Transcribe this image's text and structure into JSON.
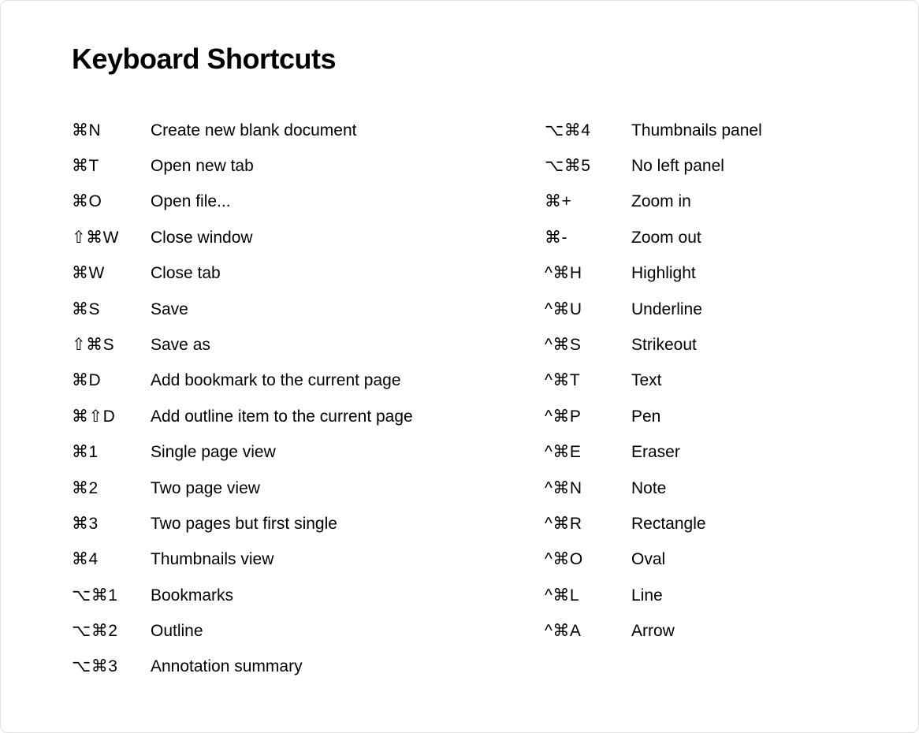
{
  "title": "Keyboard Shortcuts",
  "left": [
    {
      "keys": "⌘N",
      "desc": "Create new blank document"
    },
    {
      "keys": "⌘T",
      "desc": "Open new tab"
    },
    {
      "keys": "⌘O",
      "desc": "Open file..."
    },
    {
      "keys": "⇧⌘W",
      "desc": "Close window"
    },
    {
      "keys": "⌘W",
      "desc": "Close tab"
    },
    {
      "keys": "⌘S",
      "desc": "Save"
    },
    {
      "keys": "⇧⌘S",
      "desc": "Save as"
    },
    {
      "keys": "⌘D",
      "desc": "Add bookmark to the current page"
    },
    {
      "keys": "⌘⇧D",
      "desc": "Add outline item to the current page"
    },
    {
      "keys": "⌘1",
      "desc": "Single page view"
    },
    {
      "keys": "⌘2",
      "desc": "Two page view"
    },
    {
      "keys": "⌘3",
      "desc": "Two pages but first single"
    },
    {
      "keys": "⌘4",
      "desc": "Thumbnails view"
    },
    {
      "keys": "⌥⌘1",
      "desc": "Bookmarks"
    },
    {
      "keys": "⌥⌘2",
      "desc": "Outline"
    },
    {
      "keys": "⌥⌘3",
      "desc": "Annotation summary"
    }
  ],
  "right": [
    {
      "keys": "⌥⌘4",
      "desc": "Thumbnails panel"
    },
    {
      "keys": "⌥⌘5",
      "desc": "No left panel"
    },
    {
      "keys": "⌘+",
      "desc": "Zoom in"
    },
    {
      "keys": "⌘-",
      "desc": "Zoom out"
    },
    {
      "keys": "^⌘H",
      "desc": "Highlight"
    },
    {
      "keys": "^⌘U",
      "desc": "Underline"
    },
    {
      "keys": "^⌘S",
      "desc": "Strikeout"
    },
    {
      "keys": "^⌘T",
      "desc": "Text"
    },
    {
      "keys": "^⌘P",
      "desc": "Pen"
    },
    {
      "keys": "^⌘E",
      "desc": "Eraser"
    },
    {
      "keys": "^⌘N",
      "desc": "Note"
    },
    {
      "keys": "^⌘R",
      "desc": "Rectangle"
    },
    {
      "keys": "^⌘O",
      "desc": "Oval"
    },
    {
      "keys": "^⌘L",
      "desc": "Line"
    },
    {
      "keys": "^⌘A",
      "desc": "Arrow"
    }
  ]
}
